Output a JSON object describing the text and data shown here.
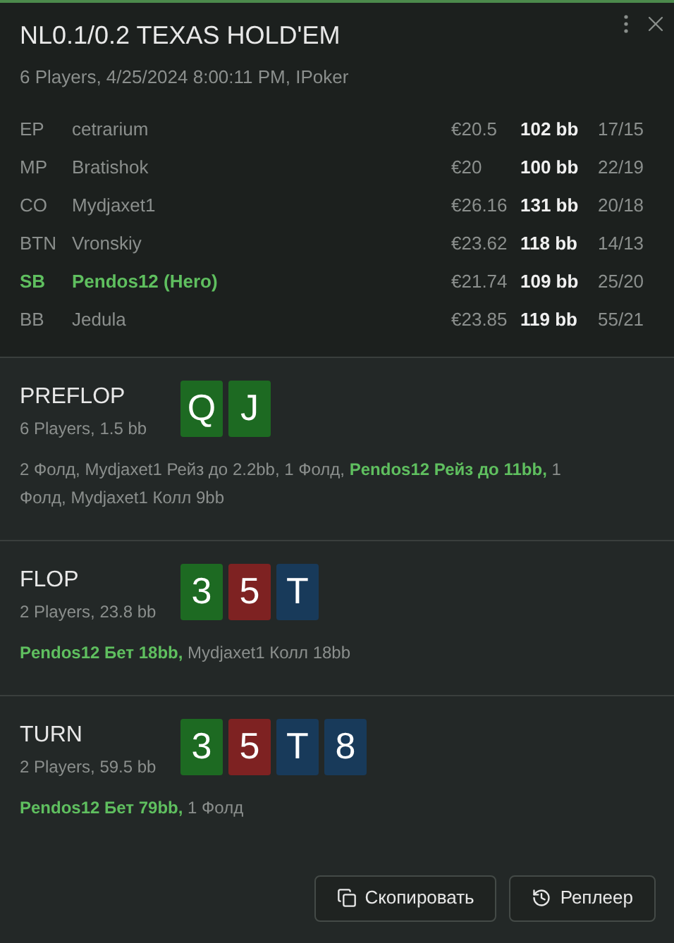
{
  "title": "NL0.1/0.2 TEXAS HOLD'EM",
  "subtitle": "6 Players, 4/25/2024 8:00:11 PM, IPoker",
  "players": [
    {
      "position": "EP",
      "name": "cetrarium",
      "stack": "€20.5",
      "bb": "102 bb",
      "stats": "17/15",
      "hero": false
    },
    {
      "position": "MP",
      "name": "Bratishok",
      "stack": "€20",
      "bb": "100 bb",
      "stats": "22/19",
      "hero": false
    },
    {
      "position": "CO",
      "name": "Mydjaxet1",
      "stack": "€26.16",
      "bb": "131 bb",
      "stats": "20/18",
      "hero": false
    },
    {
      "position": "BTN",
      "name": "Vronskiy",
      "stack": "€23.62",
      "bb": "118 bb",
      "stats": "14/13",
      "hero": false
    },
    {
      "position": "SB",
      "name": "Pendos12 (Hero)",
      "stack": "€21.74",
      "bb": "109 bb",
      "stats": "25/20",
      "hero": true
    },
    {
      "position": "BB",
      "name": "Jedula",
      "stack": "€23.85",
      "bb": "119 bb",
      "stats": "55/21",
      "hero": false
    }
  ],
  "streets": [
    {
      "name": "PREFLOP",
      "info": "6 Players, 1.5 bb",
      "cards": [
        {
          "rank": "Q",
          "color": "#1d6a22"
        },
        {
          "rank": "J",
          "color": "#1d6a22"
        }
      ],
      "actions": [
        {
          "text": "2 Фолд, Mydjaxet1 Рейз до 2.2bb, 1 Фолд, ",
          "hero": false
        },
        {
          "text": "Pendos12 Рейз до 11bb,",
          "hero": true
        },
        {
          "text": " 1 Фолд, Mydjaxet1 Колл 9bb",
          "hero": false
        }
      ]
    },
    {
      "name": "FLOP",
      "info": "2 Players, 23.8 bb",
      "cards": [
        {
          "rank": "3",
          "color": "#1d6a22"
        },
        {
          "rank": "5",
          "color": "#7e2222"
        },
        {
          "rank": "T",
          "color": "#183a5a"
        }
      ],
      "actions": [
        {
          "text": "Pendos12 Бет 18bb,",
          "hero": true
        },
        {
          "text": " Mydjaxet1 Колл 18bb",
          "hero": false
        }
      ]
    },
    {
      "name": "TURN",
      "info": "2 Players, 59.5 bb",
      "cards": [
        {
          "rank": "3",
          "color": "#1d6a22"
        },
        {
          "rank": "5",
          "color": "#7e2222"
        },
        {
          "rank": "T",
          "color": "#183a5a"
        },
        {
          "rank": "8",
          "color": "#183a5a"
        }
      ],
      "actions": [
        {
          "text": "Pendos12 Бет 79bb,",
          "hero": true
        },
        {
          "text": " 1 Фолд",
          "hero": false
        }
      ]
    }
  ],
  "buttons": [
    {
      "label": "Скопировать",
      "kind": "copy"
    },
    {
      "label": "Реплеер",
      "kind": "replay"
    }
  ]
}
